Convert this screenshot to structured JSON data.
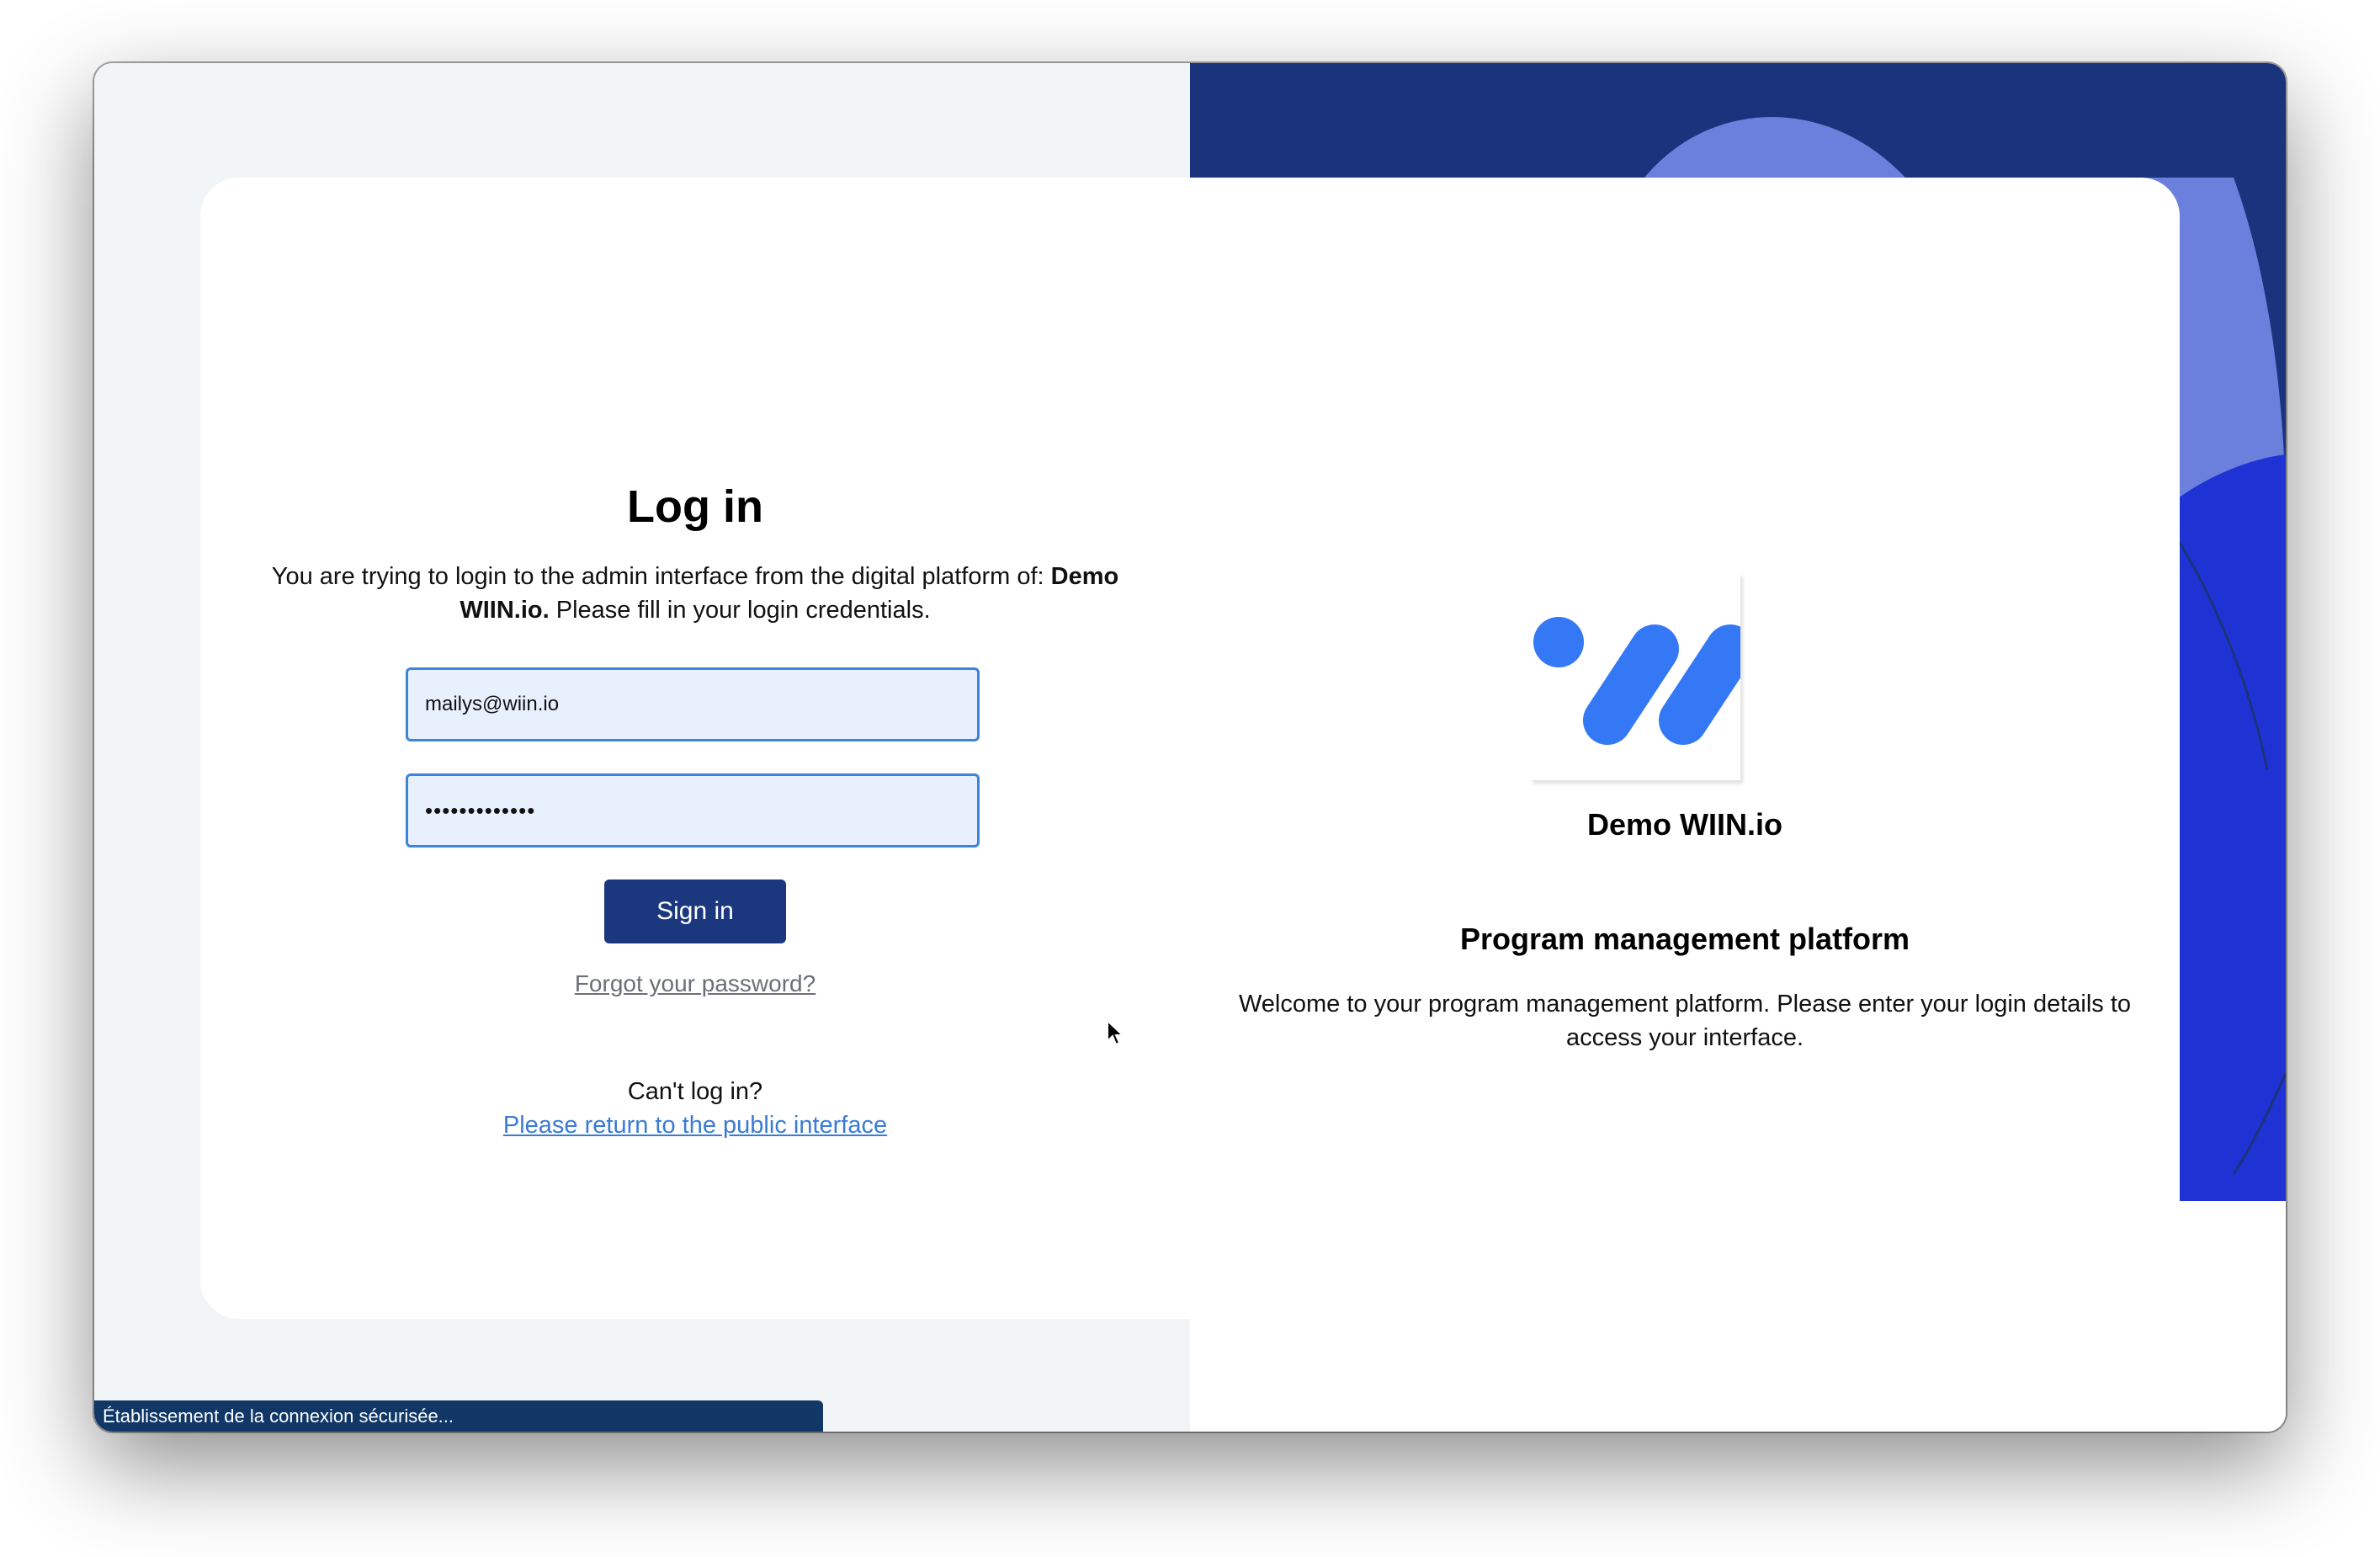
{
  "login": {
    "title": "Log in",
    "intro_prefix": "You are trying to login to the admin interface from the digital platform of: ",
    "org_name": "Demo WIIN.io.",
    "intro_suffix": " Please fill in your login credentials.",
    "email_value": "mailys@wiin.io",
    "password_value": "•••••••••••••",
    "signin_label": "Sign in",
    "forgot_label": "Forgot your password?",
    "cant_login_label": "Can't log in?",
    "public_link_label": "Please return to the public interface"
  },
  "branding": {
    "org_name": "Demo WIIN.io",
    "platform_title": "Program management platform",
    "welcome_text": "Welcome to your program management platform. Please enter your login details to access your interface.",
    "logo_icon": "wiin-logo-icon"
  },
  "status": {
    "text": "Établissement de la connexion sécurisée..."
  },
  "colors": {
    "primary_button": "#1b377e",
    "link": "#3a7bd5",
    "logo_blue": "#3478f6",
    "deco_navy": "#1a337c",
    "deco_royal": "#1f33d4",
    "deco_light": "#6a80dc",
    "status_bar": "#103766"
  }
}
